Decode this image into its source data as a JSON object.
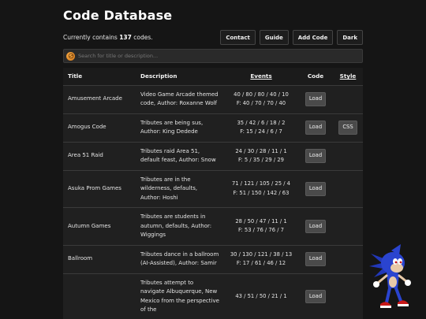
{
  "header": {
    "title": "Code Database",
    "count_prefix": "Currently contains",
    "count_value": "137",
    "count_suffix": "codes."
  },
  "toolbar": {
    "contact_label": "Contact",
    "guide_label": "Guide",
    "add_code_label": "Add Code",
    "dark_label": "Dark"
  },
  "search": {
    "placeholder": "Search for title or description...",
    "icon": "hunger-games-emblem-icon"
  },
  "table": {
    "headers": {
      "title": "Title",
      "description": "Description",
      "events": "Events",
      "code": "Code",
      "style": "Style"
    },
    "rows": [
      {
        "title": "Amusement Arcade",
        "description": "Video Game Arcade themed code, Author: Roxanne Wolf",
        "events_line1": "40 / 80 / 80 / 40 / 10",
        "events_line2": "F: 40 / 70 / 70 / 40",
        "code_label": "Load",
        "style_label": ""
      },
      {
        "title": "Amogus Code",
        "description": "Tributes are being sus, Author: King Dedede",
        "events_line1": "35 / 42 / 6 / 18 / 2",
        "events_line2": "F: 15 / 24 / 6 / 7",
        "code_label": "Load",
        "style_label": "CSS"
      },
      {
        "title": "Area 51 Raid",
        "description": "Tributes raid Area 51, default feast, Author: Snow",
        "events_line1": "24 / 30 / 28 / 11 / 1",
        "events_line2": "F: 5 / 35 / 29 / 29",
        "code_label": "Load",
        "style_label": ""
      },
      {
        "title": "Asuka Prom Games",
        "description": "Tributes are in the wilderness, defaults, Author: Hoshi",
        "events_line1": "71 / 121 / 105 / 25 / 4",
        "events_line2": "F: 51 / 150 / 142 / 63",
        "code_label": "Load",
        "style_label": ""
      },
      {
        "title": "Autumn Games",
        "description": "Tributes are students in autumn, defaults, Author: Wiggings",
        "events_line1": "28 / 50 / 47 / 11 / 1",
        "events_line2": "F: 53 / 76 / 76 / 7",
        "code_label": "Load",
        "style_label": ""
      },
      {
        "title": "Ballroom",
        "description": "Tributes dance in a ballroom (AI-Assisted), Author: Samir",
        "events_line1": "30 / 130 / 121 / 38 / 13",
        "events_line2": "F: 17 / 61 / 46 / 12",
        "code_label": "Load",
        "style_label": ""
      },
      {
        "title": "",
        "description": "Tributes attempt to navigate Albuquerque, New Mexico from the perspective of the",
        "events_line1": "43 / 51 / 50 / 21 / 1",
        "events_line2": "",
        "code_label": "Load",
        "style_label": ""
      }
    ]
  }
}
